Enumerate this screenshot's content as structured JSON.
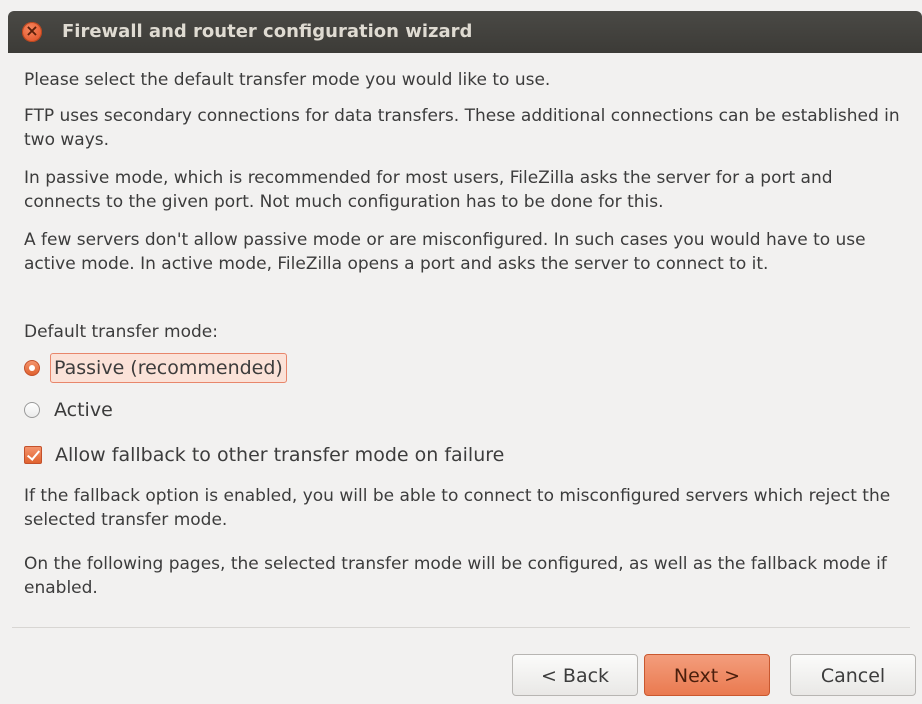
{
  "window": {
    "title": "Firewall and router configuration wizard",
    "close_icon": "close-icon"
  },
  "content": {
    "intro": "Please select the default transfer mode you would like to use.",
    "ftp_info": "FTP uses secondary connections for data transfers. These additional connections can be established in two ways.",
    "passive_info": "In passive mode, which is recommended for most users, FileZilla asks the server for a port and connects to the given port. Not much configuration has to be done for this.",
    "active_info": "A few servers don't allow passive mode or are misconfigured. In such cases you would have to use active mode. In active mode, FileZilla opens a port and asks the server to connect to it.",
    "mode_label": "Default transfer mode:",
    "options": {
      "passive": "Passive (recommended)",
      "active": "Active",
      "selected": "passive"
    },
    "fallback": {
      "label": "Allow fallback to other transfer mode on failure",
      "checked": true
    },
    "fallback_info": "If the fallback option is enabled, you will be able to connect to misconfigured servers which reject the selected transfer mode.",
    "following_info": "On the following pages, the selected transfer mode will be configured, as well as the fallback mode if enabled."
  },
  "buttons": {
    "back": "< Back",
    "next": "Next >",
    "cancel": "Cancel"
  },
  "colors": {
    "accent": "#e8764a",
    "titlebar": "#3c3b37",
    "background": "#f2f1f0"
  }
}
